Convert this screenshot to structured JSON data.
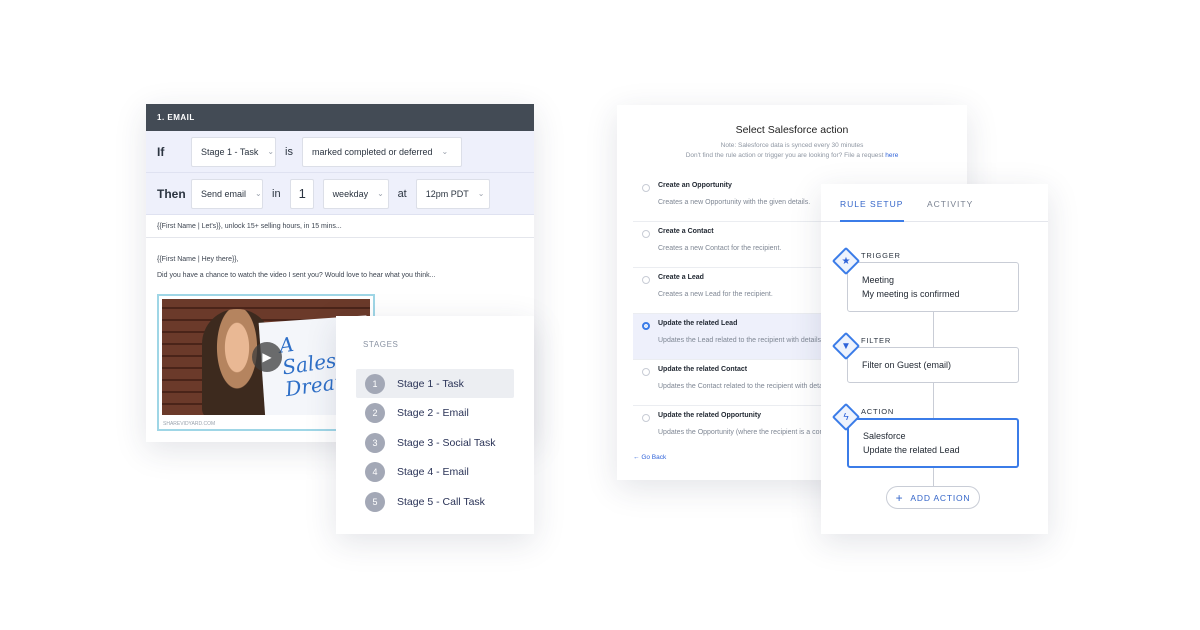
{
  "email": {
    "header": "1. EMAIL",
    "if_row": {
      "keyword": "If",
      "stage_value": "Stage 1 - Task",
      "is": "is",
      "status_value": "marked completed or deferred"
    },
    "then_row": {
      "keyword": "Then",
      "action_value": "Send email",
      "in": "in",
      "number": "1",
      "unit": "weekday",
      "at": "at",
      "time": "12pm PDT"
    },
    "subject": "{{First Name | Let's}}, unlock 15+ selling hours, in 15 mins...",
    "greeting": "{{First Name | Hey there}},",
    "body": "Did you have a chance to watch the video I sent you? Would love to hear what you think...",
    "video_board_text": "A SalesOps Dream!",
    "video_caption": "SHAREVIDYARD.COM"
  },
  "stages": {
    "title": "STAGES",
    "items": [
      {
        "num": "1",
        "label": "Stage 1 - Task"
      },
      {
        "num": "2",
        "label": "Stage 2 - Email"
      },
      {
        "num": "3",
        "label": "Stage 3 - Social Task"
      },
      {
        "num": "4",
        "label": "Stage 4 - Email"
      },
      {
        "num": "5",
        "label": "Stage 5 - Call Task"
      }
    ]
  },
  "salesforce": {
    "title": "Select Salesforce action",
    "note": "Note: Salesforce data is synced every 30 minutes",
    "note2": "Don't find the rule action or trigger you are looking for? File a request",
    "note2_link": "here",
    "options": [
      {
        "title": "Create an Opportunity",
        "desc": "Creates a new Opportunity with the given details."
      },
      {
        "title": "Create a Contact",
        "desc": "Creates a new Contact for the recipient."
      },
      {
        "title": "Create a Lead",
        "desc": "Creates a new Lead for the recipient."
      },
      {
        "title": "Update the related Lead",
        "desc": "Updates the Lead related to the recipient with details."
      },
      {
        "title": "Update the related Contact",
        "desc": "Updates the Contact related to the recipient with details."
      },
      {
        "title": "Update the related Opportunity",
        "desc": "Updates the Opportunity (where the recipient is a contact)."
      }
    ],
    "selected_index": 3,
    "go_back": "Go Back"
  },
  "rule": {
    "tabs": {
      "active": "RULE SETUP",
      "inactive": "ACTIVITY"
    },
    "trigger": {
      "label": "TRIGGER",
      "title": "Meeting",
      "subtitle": "My meeting is confirmed"
    },
    "filter": {
      "label": "FILTER",
      "title": "Filter on Guest (email)"
    },
    "action": {
      "label": "ACTION",
      "title": "Salesforce",
      "subtitle": "Update the related Lead"
    },
    "add_action": "ADD ACTION"
  },
  "colors": {
    "accent": "#3b7ce8",
    "header_dark": "#434b55",
    "row_tint": "#eef0fb"
  }
}
